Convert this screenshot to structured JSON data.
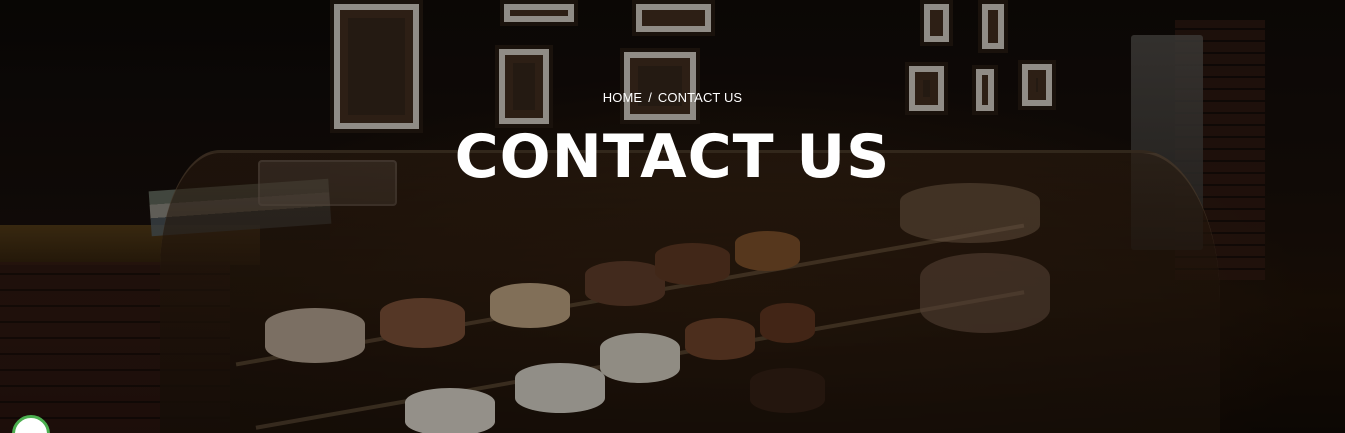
{
  "breadcrumb": {
    "home_label": "HOME",
    "separator": "/",
    "current_label": "CONTACT US"
  },
  "hero": {
    "title": "CONTACT US",
    "background_description_icon": "bakery-display-case-image"
  },
  "colors": {
    "title_text": "#ffffff",
    "overlay": "#000000",
    "chat_ring": "#4caf50"
  },
  "chat_widget": {
    "icon": "chat-bubble-icon"
  }
}
